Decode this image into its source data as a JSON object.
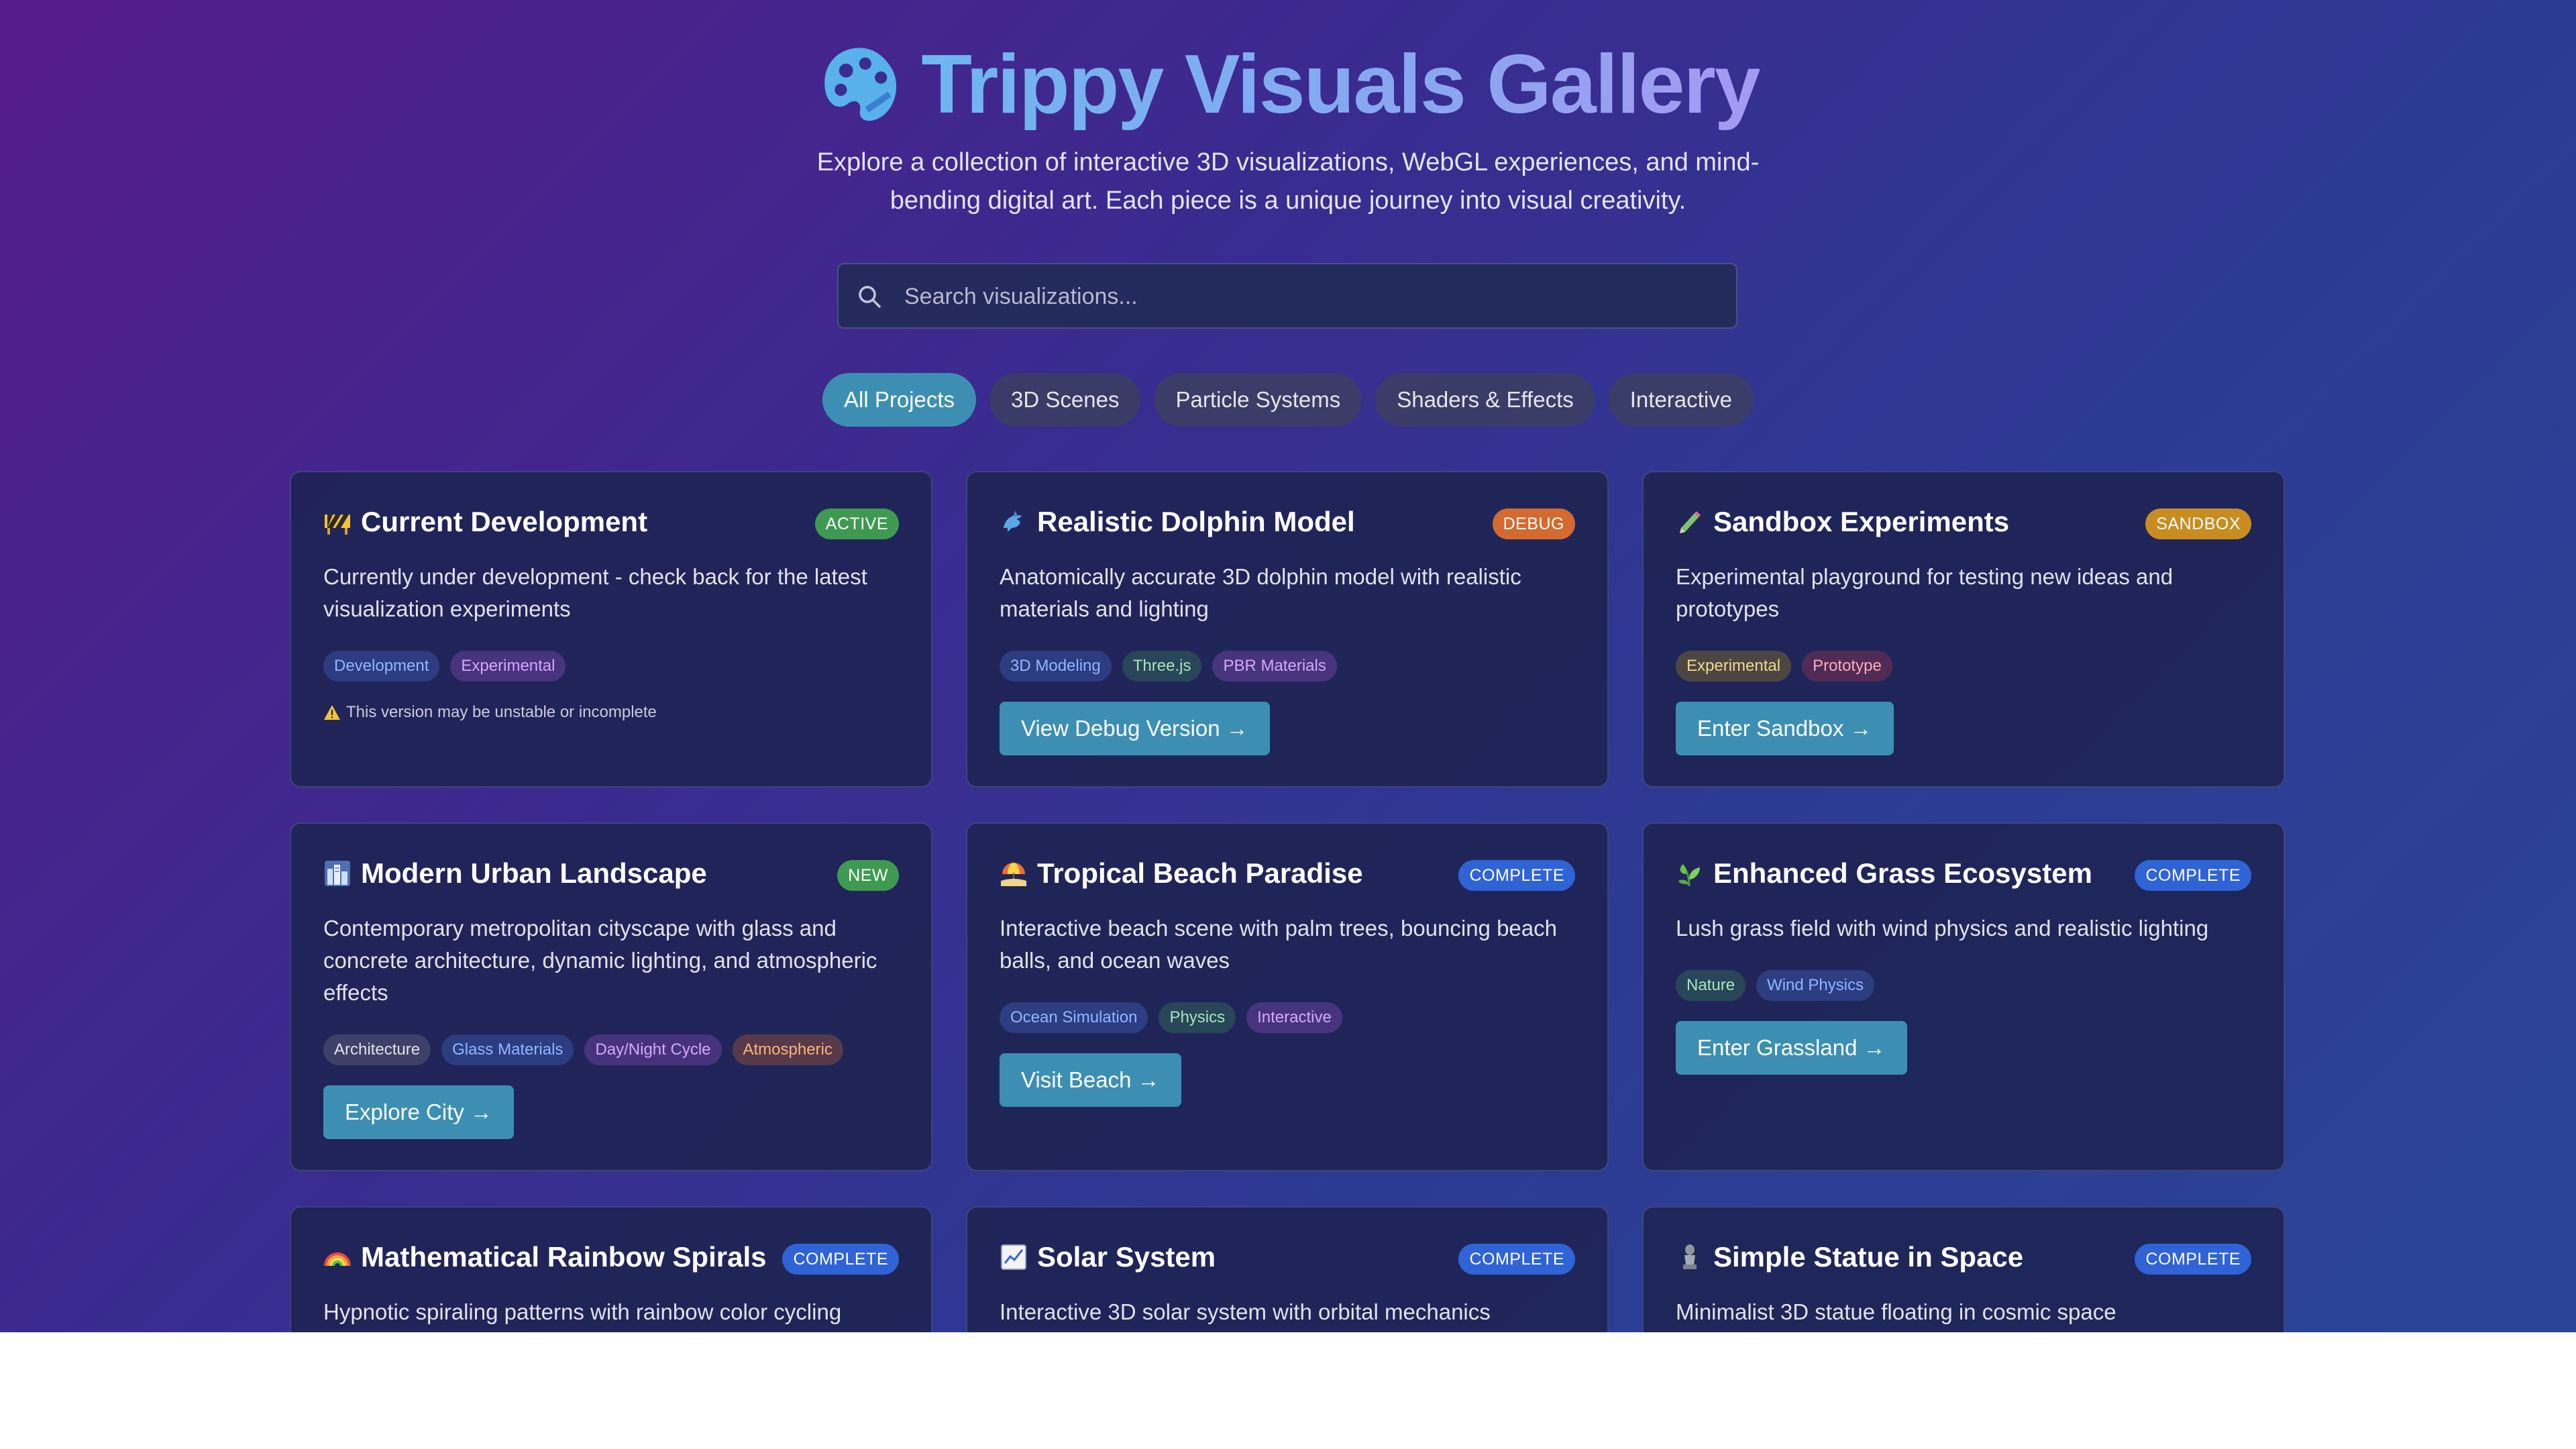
{
  "header": {
    "title": "Trippy Visuals Gallery",
    "subtitle": "Explore a collection of interactive 3D visualizations, WebGL experiences, and mind-bending digital art. Each piece is a unique journey into visual creativity."
  },
  "search": {
    "placeholder": "Search visualizations..."
  },
  "filters": [
    {
      "label": "All Projects",
      "active": true
    },
    {
      "label": "3D Scenes",
      "active": false
    },
    {
      "label": "Particle Systems",
      "active": false
    },
    {
      "label": "Shaders & Effects",
      "active": false
    },
    {
      "label": "Interactive",
      "active": false
    }
  ],
  "cards": [
    {
      "icon": "construction-icon",
      "title": "Current Development",
      "badge": "ACTIVE",
      "description": "Currently under development - check back for the latest visualization experiments",
      "tags": [
        "Development",
        "Experimental"
      ],
      "warning": "This version may be unstable or incomplete"
    },
    {
      "icon": "dolphin-icon",
      "title": "Realistic Dolphin Model",
      "badge": "DEBUG",
      "description": "Anatomically accurate 3D dolphin model with realistic materials and lighting",
      "tags": [
        "3D Modeling",
        "Three.js",
        "PBR Materials"
      ],
      "button": "View Debug Version →"
    },
    {
      "icon": "pencil-icon",
      "title": "Sandbox Experiments",
      "badge": "SANDBOX",
      "description": "Experimental playground for testing new ideas and prototypes",
      "tags": [
        "Experimental",
        "Prototype"
      ],
      "button": "Enter Sandbox →"
    },
    {
      "icon": "city-icon",
      "title": "Modern Urban Landscape",
      "badge": "NEW",
      "description": "Contemporary metropolitan cityscape with glass and concrete architecture, dynamic lighting, and atmospheric effects",
      "tags": [
        "Architecture",
        "Glass Materials",
        "Day/Night Cycle",
        "Atmospheric"
      ],
      "button": "Explore City →"
    },
    {
      "icon": "beach-icon",
      "title": "Tropical Beach Paradise",
      "badge": "COMPLETE",
      "description": "Interactive beach scene with palm trees, bouncing beach balls, and ocean waves",
      "tags": [
        "Ocean Simulation",
        "Physics",
        "Interactive"
      ],
      "button": "Visit Beach →"
    },
    {
      "icon": "herb-icon",
      "title": "Enhanced Grass Ecosystem",
      "badge": "COMPLETE",
      "description": "Lush grass field with wind physics and realistic lighting",
      "tags": [
        "Nature",
        "Wind Physics"
      ],
      "button": "Enter Grassland →"
    },
    {
      "icon": "rainbow-icon",
      "title": "Mathematical Rainbow Spirals",
      "badge": "COMPLETE",
      "description": "Hypnotic spiraling patterns with rainbow color cycling"
    },
    {
      "icon": "chart-icon",
      "title": "Solar System",
      "badge": "COMPLETE",
      "description": "Interactive 3D solar system with orbital mechanics"
    },
    {
      "icon": "statue-icon",
      "title": "Simple Statue in Space",
      "badge": "COMPLETE",
      "description": "Minimalist 3D statue floating in cosmic space"
    }
  ],
  "colors": {
    "accent": "#3c8fb3",
    "badge_active": "#3e9a51",
    "badge_debug": "#d46a2f",
    "badge_sandbox": "#c98c21",
    "badge_complete": "#2f63d6"
  }
}
